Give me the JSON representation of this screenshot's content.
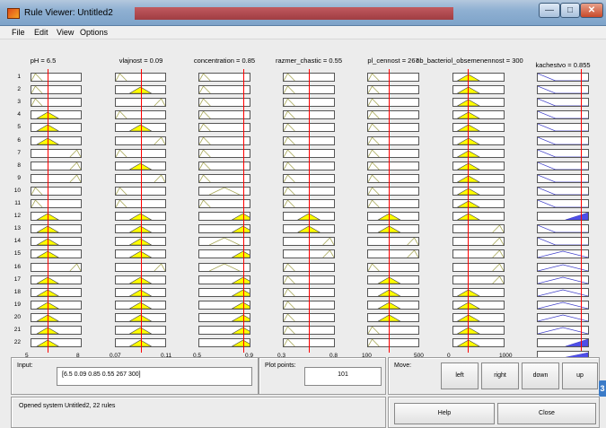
{
  "window": {
    "title": "Rule Viewer: Untitled2",
    "minimize_glyph": "—",
    "maximize_glyph": "□",
    "close_glyph": "✕"
  },
  "menu": [
    "File",
    "Edit",
    "View",
    "Options"
  ],
  "inputs": [
    {
      "label": "pH = 6.5",
      "min": "5",
      "max": "8",
      "marker": 0.33
    },
    {
      "label": "vlajnost = 0.09",
      "min": "0.07",
      "max": "0.11",
      "marker": 0.5
    },
    {
      "label": "concentration = 0.85",
      "min": "0.5",
      "max": "0.9",
      "marker": 0.87
    },
    {
      "label": "razmer_chastic = 0.55",
      "min": "0.3",
      "max": "0.8",
      "marker": 0.5
    },
    {
      "label": "pl_cennost = 267",
      "min": "100",
      "max": "500",
      "marker": 0.42
    },
    {
      "label": "ob_bacteriol_obsemenennost = 300",
      "min": "0",
      "max": "1000",
      "marker": 0.3
    }
  ],
  "output": {
    "label": "kachestvo = 0.855",
    "marker": 0.85
  },
  "row_labels": [
    "1",
    "2",
    "3",
    "4",
    "5",
    "6",
    "7",
    "8",
    "9",
    "10",
    "11",
    "12",
    "13",
    "14",
    "15",
    "16",
    "17",
    "18",
    "19",
    "20",
    "21",
    "22"
  ],
  "input_field": {
    "label": "Input:",
    "value": "[6.5 0.09 0.85 0.55 267 300]"
  },
  "plot_points": {
    "label": "Plot points:",
    "value": "101"
  },
  "move": {
    "label": "Move:",
    "buttons": [
      "left",
      "right",
      "down",
      "up"
    ]
  },
  "status": {
    "text": "Opened system Untitled2, 22 rules"
  },
  "help_label": "Help",
  "close_label": "Close",
  "side_tab_glyph": "3",
  "colors": {
    "fill_yellow": "#ffff00",
    "unfilled_mf": "#a8a858",
    "output_fill": "#4f4fe8",
    "output_line": "#3c3cc8",
    "marker": "#ff0000"
  }
}
